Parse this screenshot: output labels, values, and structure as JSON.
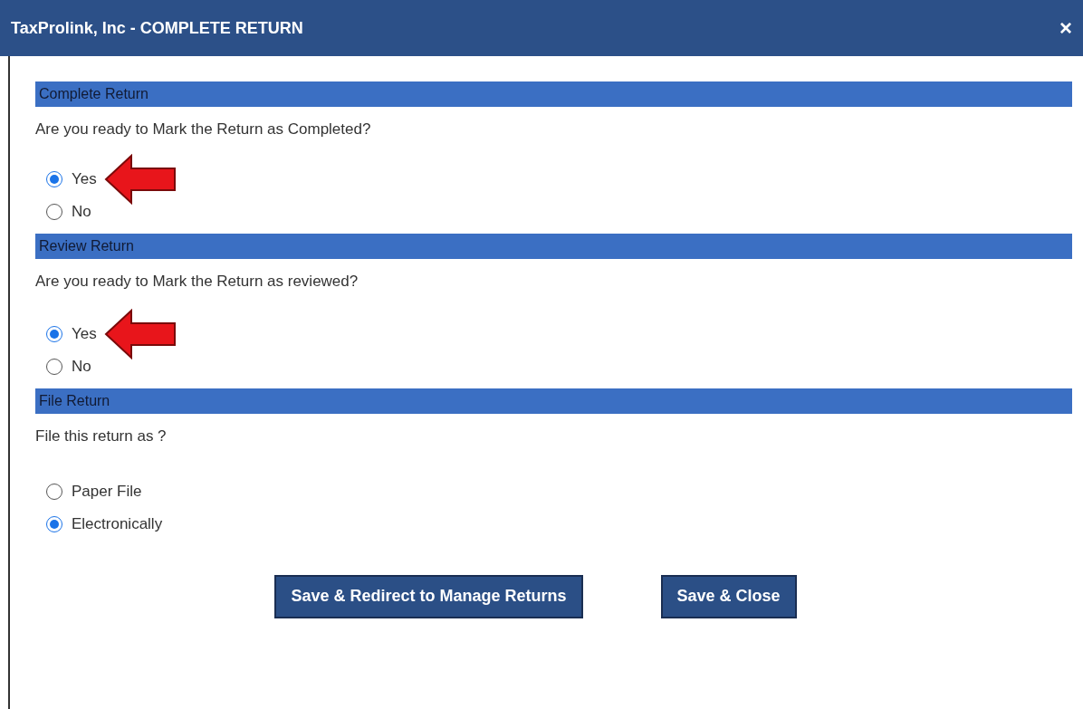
{
  "window": {
    "title": "TaxProlink, Inc - COMPLETE RETURN",
    "close": "×"
  },
  "sections": [
    {
      "heading": "Complete Return",
      "question": "Are you ready to Mark the Return as Completed?",
      "options": [
        {
          "label": "Yes",
          "selected": true,
          "pointer_arrow": true
        },
        {
          "label": "No",
          "selected": false,
          "pointer_arrow": false
        }
      ]
    },
    {
      "heading": "Review Return",
      "question": "Are you ready to Mark the Return as reviewed?",
      "options": [
        {
          "label": "Yes",
          "selected": true,
          "pointer_arrow": true
        },
        {
          "label": "No",
          "selected": false,
          "pointer_arrow": false
        }
      ]
    },
    {
      "heading": "File Return",
      "question": "File this return as ?",
      "options": [
        {
          "label": "Paper File",
          "selected": false,
          "pointer_arrow": false
        },
        {
          "label": "Electronically",
          "selected": true,
          "pointer_arrow": false
        }
      ]
    }
  ],
  "buttons": [
    "Save & Redirect to Manage Returns",
    "Save & Close"
  ]
}
